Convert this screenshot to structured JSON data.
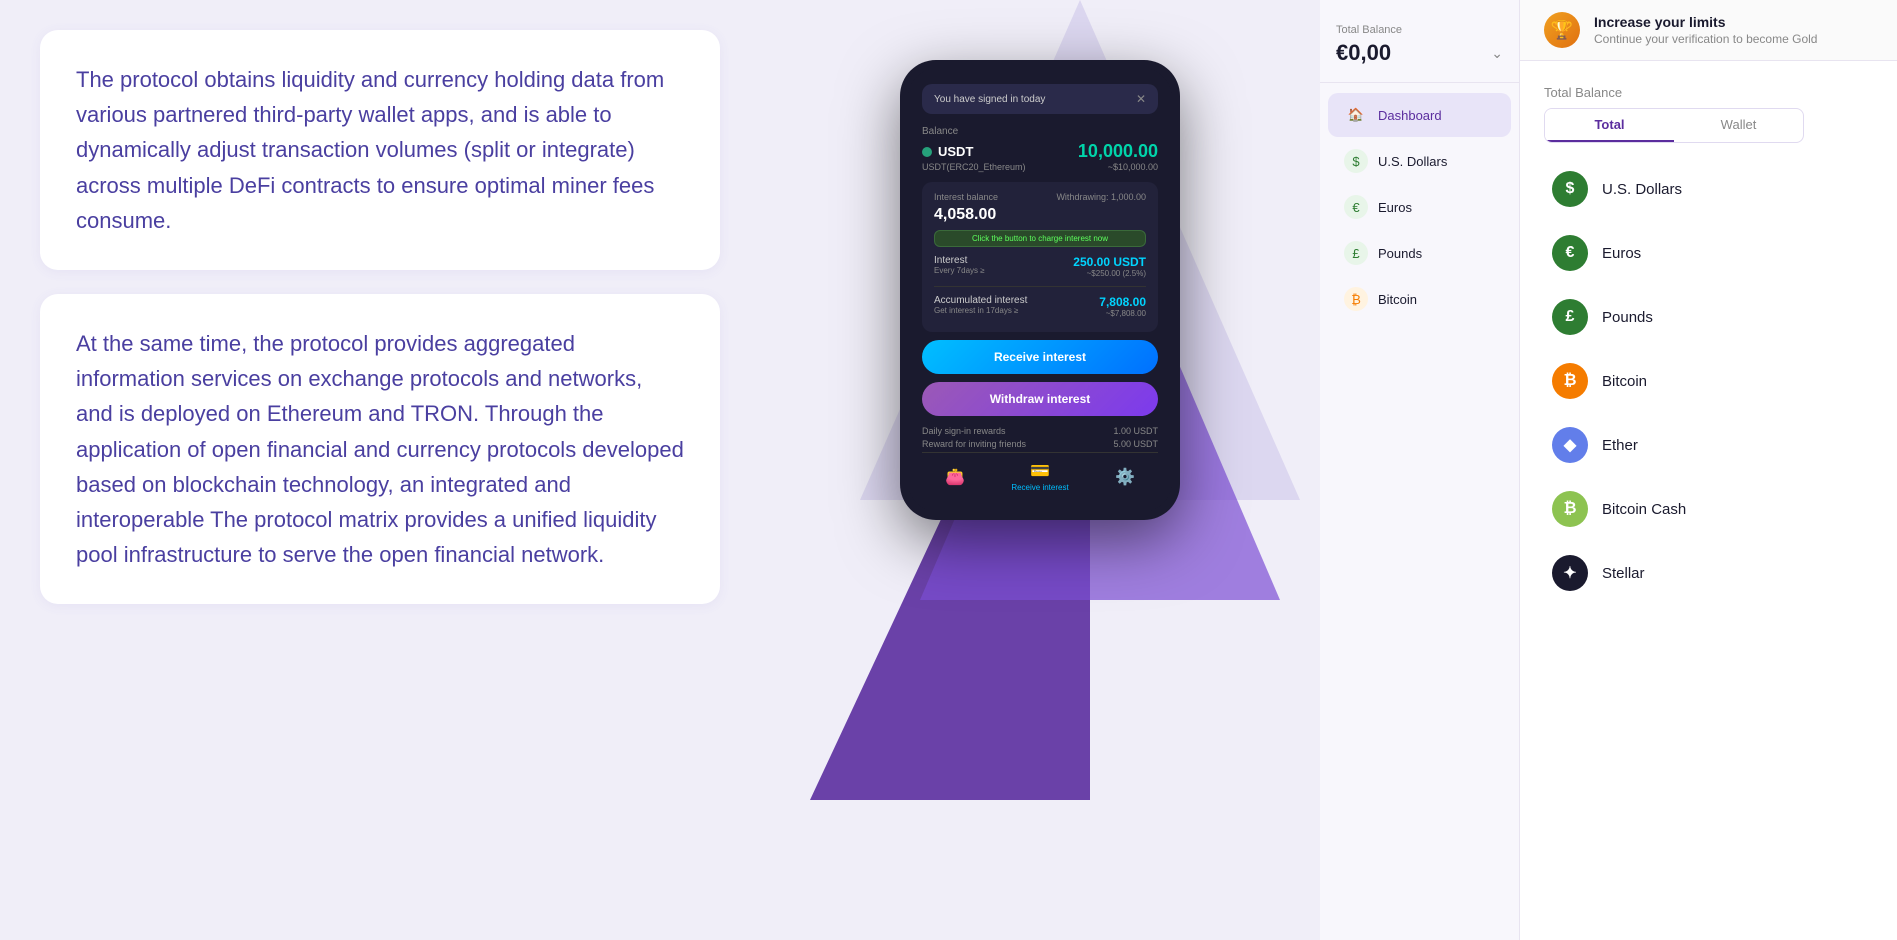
{
  "leftPanel": {
    "card1": {
      "text": "The protocol obtains liquidity and currency holding data from various partnered third-party wallet apps, and is able to dynamically adjust transaction volumes (split or integrate) across multiple DeFi contracts to ensure optimal miner fees consume."
    },
    "card2": {
      "text": "At the same time, the protocol provides aggregated information services on exchange protocols and networks, and is deployed on Ethereum and TRON. Through the application of open financial and currency protocols developed based on blockchain technology, an integrated and interoperable The protocol matrix provides a unified liquidity pool infrastructure to serve the open financial network."
    }
  },
  "phone": {
    "notification": "You have signed in today",
    "balanceLabel": "Balance",
    "usdtLabel": "USDT",
    "usdtAmount": "10,000.00",
    "usdtSub": "~$10,000.00",
    "usdtErc": "USDT(ERC20_Ethereum)",
    "interestBalanceLabel": "Interest balance",
    "withdrawingLabel": "Withdrawing: 1,000.00",
    "interestBalance": "4,058.00",
    "chargeBtn": "Click the button to charge interest now",
    "interestLabel": "Interest",
    "interestAmount": "250.00 USDT",
    "interestSub": "~$250.00 (2.5%)",
    "interestEvery": "Every 7days ≥",
    "accumulatedLabel": "Accumulated interest",
    "accumulatedAmount": "7,808.00",
    "accumulatedSub": "~$7,808.00",
    "accumulatedEvery": "Get interest in 17days ≥",
    "receiveBtnLabel": "Receive interest",
    "withdrawBtnLabel": "Withdraw interest",
    "dailySignLabel": "Daily sign-in rewards",
    "dailySignAmount": "1.00 USDT",
    "inviteLabel": "Reward for inviting friends",
    "inviteAmount": "5.00 USDT"
  },
  "sidebar": {
    "balanceLabel": "Total Balance",
    "balanceAmount": "€0,00",
    "navItems": [
      {
        "id": "dashboard",
        "label": "Dashboard",
        "icon": "🏠",
        "active": true
      },
      {
        "id": "usd",
        "label": "U.S. Dollars",
        "icon": "$",
        "active": false
      },
      {
        "id": "eur",
        "label": "Euros",
        "icon": "€",
        "active": false
      },
      {
        "id": "gbp",
        "label": "Pounds",
        "icon": "£",
        "active": false
      },
      {
        "id": "btc",
        "label": "Bitcoin",
        "icon": "₿",
        "active": false
      }
    ]
  },
  "main": {
    "banner": {
      "icon": "🏆",
      "title": "Increase your limits",
      "subtitle": "Continue your verification to become Gold"
    },
    "totalBalanceLabel": "Total Balance",
    "tabs": [
      {
        "id": "total",
        "label": "Total",
        "active": true
      },
      {
        "id": "wallet",
        "label": "Wallet",
        "active": false
      }
    ],
    "currencies": [
      {
        "id": "usd",
        "label": "U.S. Dollars",
        "icon": "$",
        "class": "usd"
      },
      {
        "id": "eur",
        "label": "Euros",
        "icon": "€",
        "class": "eur"
      },
      {
        "id": "gbp",
        "label": "Pounds",
        "icon": "£",
        "class": "gbp"
      },
      {
        "id": "btc",
        "label": "Bitcoin",
        "icon": "₿",
        "class": "btc"
      },
      {
        "id": "eth",
        "label": "Ether",
        "icon": "◆",
        "class": "eth"
      },
      {
        "id": "bch",
        "label": "Bitcoin Cash",
        "icon": "₿",
        "class": "bch"
      },
      {
        "id": "xlm",
        "label": "Stellar",
        "icon": "✦",
        "class": "xlm"
      }
    ]
  }
}
